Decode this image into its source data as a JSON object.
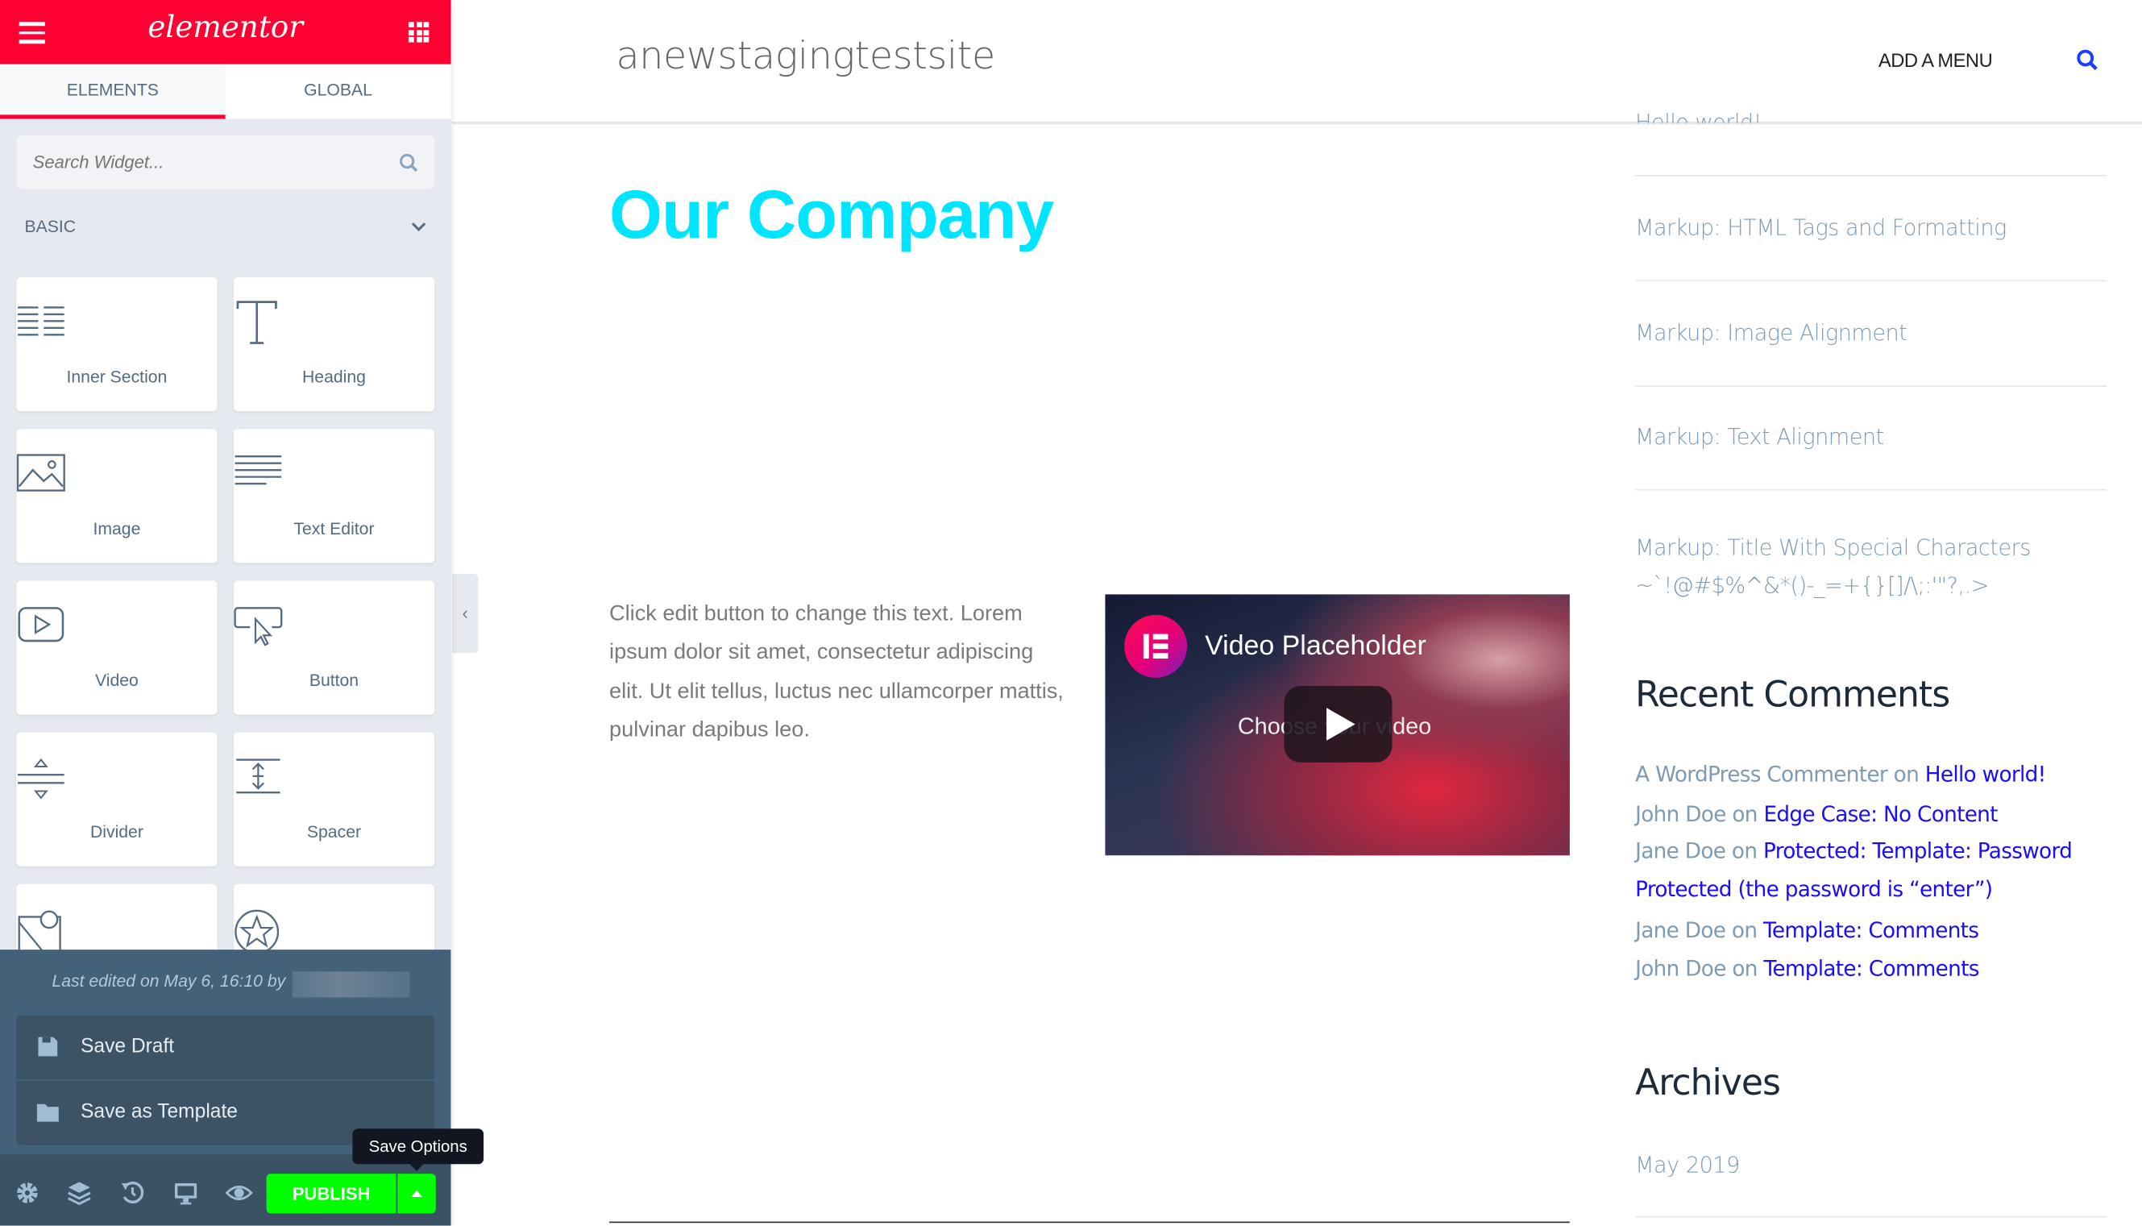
{
  "editor": {
    "logo": "elementor",
    "tabs": [
      {
        "label": "ELEMENTS",
        "active": true
      },
      {
        "label": "GLOBAL",
        "active": false
      }
    ],
    "search": {
      "placeholder": "Search Widget...",
      "value": ""
    },
    "category": "BASIC",
    "widgets": [
      {
        "label": "Inner Section",
        "icon": "inner-section-icon"
      },
      {
        "label": "Heading",
        "icon": "heading-icon"
      },
      {
        "label": "Image",
        "icon": "image-icon"
      },
      {
        "label": "Text Editor",
        "icon": "text-editor-icon"
      },
      {
        "label": "Video",
        "icon": "video-icon"
      },
      {
        "label": "Button",
        "icon": "button-icon"
      },
      {
        "label": "Divider",
        "icon": "divider-icon"
      },
      {
        "label": "Spacer",
        "icon": "spacer-icon"
      },
      {
        "label": "",
        "icon": "google-maps-icon"
      },
      {
        "label": "",
        "icon": "star-icon"
      }
    ],
    "last_edited": "Last edited on May 6, 16:10 by",
    "save_menu": [
      {
        "label": "Save Draft",
        "icon": "save-icon"
      },
      {
        "label": "Save as Template",
        "icon": "folder-icon"
      }
    ],
    "publish_label": "PUBLISH",
    "tooltip": "Save Options",
    "colors": {
      "brand": "#ff0033",
      "publish": "#00ff00",
      "panel": "#e6e9ef",
      "bottom": "#436178"
    }
  },
  "site": {
    "title": "anewstagingtestsite",
    "menu": "ADD A MENU",
    "heading": "Our Company",
    "heading_color": "#00e5ff",
    "paragraph": "Click edit button to change this text. Lorem ipsum dolor sit amet, consectetur adipiscing elit. Ut elit tellus, luctus nec ullamcorper mattis, pulvinar dapibus leo.",
    "video": {
      "title": "Video Placeholder",
      "subtitle": "Choose your video"
    },
    "recent_posts": [
      "Hello world!",
      "Markup: HTML Tags and Formatting",
      "Markup: Image Alignment",
      "Markup: Text Alignment",
      "Markup: Title With Special Characters ~`!@#$%^&*()-_=+{}[]/\\;:'\"?,.>"
    ],
    "recent_comments_title": "Recent Comments",
    "comments": [
      {
        "author": "A WordPress Commenter",
        "on": "on",
        "post": "Hello world!"
      },
      {
        "author": "John Doe",
        "on": "on",
        "post": "Edge Case: No Content"
      },
      {
        "author": "Jane Doe",
        "on": "on",
        "post": "Protected: Template: Password Protected (the password is “enter”)"
      },
      {
        "author": "Jane Doe",
        "on": "on",
        "post": "Template: Comments"
      },
      {
        "author": "John Doe",
        "on": "on",
        "post": "Template: Comments"
      }
    ],
    "archives_title": "Archives",
    "archives": [
      "May 2019"
    ]
  }
}
